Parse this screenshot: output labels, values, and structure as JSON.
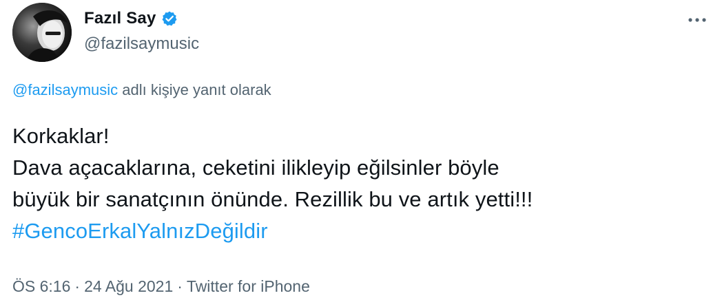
{
  "author": {
    "display_name": "Fazıl Say",
    "handle": "@fazilsaymusic",
    "verified": true,
    "avatar_icon": "profile-photo"
  },
  "actions": {
    "more_icon": "more-horizontal-icon"
  },
  "reply": {
    "mention": "@fazilsaymusic",
    "suffix": " adlı kişiye yanıt olarak"
  },
  "tweet": {
    "lines": [
      "Korkaklar!",
      "Dava açacaklarına, ceketini ilikleyip eğilsinler böyle",
      "büyük bir sanatçının önünde. Rezillik bu ve artık yetti!!!"
    ],
    "hashtag": "#GencoErkalYalnızDeğildir"
  },
  "meta": {
    "time": "ÖS 6:16",
    "date": "24 Ağu 2021",
    "separator": "·",
    "source": "Twitter for iPhone"
  },
  "colors": {
    "link": "#1d9bf0",
    "text": "#0f1419",
    "secondary": "#536471",
    "verified_badge": "#1d9bf0"
  }
}
